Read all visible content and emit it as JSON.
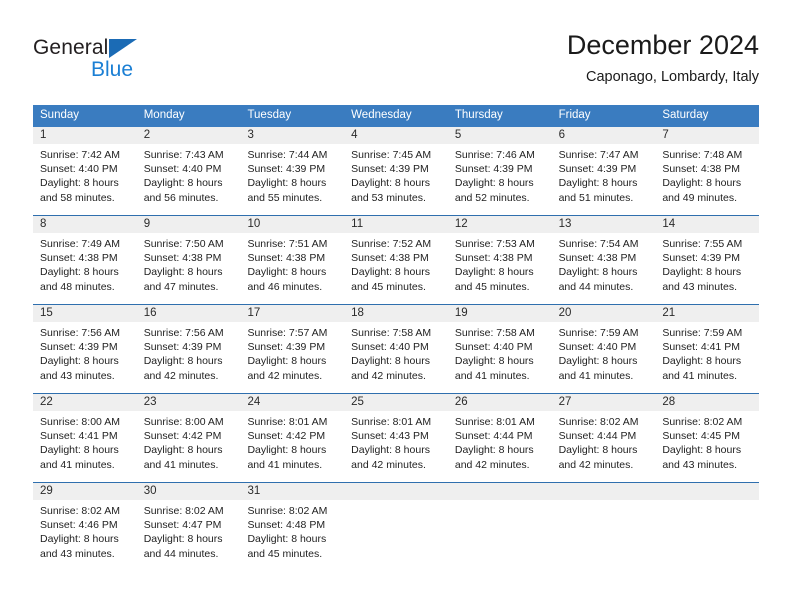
{
  "brand": {
    "name_part1": "General",
    "name_part2": "Blue",
    "triangle_icon": "triangle-icon",
    "accent_color": "#1b6bb5",
    "blue_text_color": "#1b7fd4"
  },
  "header": {
    "title": "December 2024",
    "subtitle": "Caponago, Lombardy, Italy"
  },
  "calendar": {
    "header_bg": "#3a7cc0",
    "row_separator_color": "#2f6fae",
    "day_band_bg": "#efefef",
    "weekdays": [
      "Sunday",
      "Monday",
      "Tuesday",
      "Wednesday",
      "Thursday",
      "Friday",
      "Saturday"
    ],
    "weeks": [
      [
        {
          "day": "1",
          "sunrise": "Sunrise: 7:42 AM",
          "sunset": "Sunset: 4:40 PM",
          "daylight_line1": "Daylight: 8 hours",
          "daylight_line2": "and 58 minutes."
        },
        {
          "day": "2",
          "sunrise": "Sunrise: 7:43 AM",
          "sunset": "Sunset: 4:40 PM",
          "daylight_line1": "Daylight: 8 hours",
          "daylight_line2": "and 56 minutes."
        },
        {
          "day": "3",
          "sunrise": "Sunrise: 7:44 AM",
          "sunset": "Sunset: 4:39 PM",
          "daylight_line1": "Daylight: 8 hours",
          "daylight_line2": "and 55 minutes."
        },
        {
          "day": "4",
          "sunrise": "Sunrise: 7:45 AM",
          "sunset": "Sunset: 4:39 PM",
          "daylight_line1": "Daylight: 8 hours",
          "daylight_line2": "and 53 minutes."
        },
        {
          "day": "5",
          "sunrise": "Sunrise: 7:46 AM",
          "sunset": "Sunset: 4:39 PM",
          "daylight_line1": "Daylight: 8 hours",
          "daylight_line2": "and 52 minutes."
        },
        {
          "day": "6",
          "sunrise": "Sunrise: 7:47 AM",
          "sunset": "Sunset: 4:39 PM",
          "daylight_line1": "Daylight: 8 hours",
          "daylight_line2": "and 51 minutes."
        },
        {
          "day": "7",
          "sunrise": "Sunrise: 7:48 AM",
          "sunset": "Sunset: 4:38 PM",
          "daylight_line1": "Daylight: 8 hours",
          "daylight_line2": "and 49 minutes."
        }
      ],
      [
        {
          "day": "8",
          "sunrise": "Sunrise: 7:49 AM",
          "sunset": "Sunset: 4:38 PM",
          "daylight_line1": "Daylight: 8 hours",
          "daylight_line2": "and 48 minutes."
        },
        {
          "day": "9",
          "sunrise": "Sunrise: 7:50 AM",
          "sunset": "Sunset: 4:38 PM",
          "daylight_line1": "Daylight: 8 hours",
          "daylight_line2": "and 47 minutes."
        },
        {
          "day": "10",
          "sunrise": "Sunrise: 7:51 AM",
          "sunset": "Sunset: 4:38 PM",
          "daylight_line1": "Daylight: 8 hours",
          "daylight_line2": "and 46 minutes."
        },
        {
          "day": "11",
          "sunrise": "Sunrise: 7:52 AM",
          "sunset": "Sunset: 4:38 PM",
          "daylight_line1": "Daylight: 8 hours",
          "daylight_line2": "and 45 minutes."
        },
        {
          "day": "12",
          "sunrise": "Sunrise: 7:53 AM",
          "sunset": "Sunset: 4:38 PM",
          "daylight_line1": "Daylight: 8 hours",
          "daylight_line2": "and 45 minutes."
        },
        {
          "day": "13",
          "sunrise": "Sunrise: 7:54 AM",
          "sunset": "Sunset: 4:38 PM",
          "daylight_line1": "Daylight: 8 hours",
          "daylight_line2": "and 44 minutes."
        },
        {
          "day": "14",
          "sunrise": "Sunrise: 7:55 AM",
          "sunset": "Sunset: 4:39 PM",
          "daylight_line1": "Daylight: 8 hours",
          "daylight_line2": "and 43 minutes."
        }
      ],
      [
        {
          "day": "15",
          "sunrise": "Sunrise: 7:56 AM",
          "sunset": "Sunset: 4:39 PM",
          "daylight_line1": "Daylight: 8 hours",
          "daylight_line2": "and 43 minutes."
        },
        {
          "day": "16",
          "sunrise": "Sunrise: 7:56 AM",
          "sunset": "Sunset: 4:39 PM",
          "daylight_line1": "Daylight: 8 hours",
          "daylight_line2": "and 42 minutes."
        },
        {
          "day": "17",
          "sunrise": "Sunrise: 7:57 AM",
          "sunset": "Sunset: 4:39 PM",
          "daylight_line1": "Daylight: 8 hours",
          "daylight_line2": "and 42 minutes."
        },
        {
          "day": "18",
          "sunrise": "Sunrise: 7:58 AM",
          "sunset": "Sunset: 4:40 PM",
          "daylight_line1": "Daylight: 8 hours",
          "daylight_line2": "and 42 minutes."
        },
        {
          "day": "19",
          "sunrise": "Sunrise: 7:58 AM",
          "sunset": "Sunset: 4:40 PM",
          "daylight_line1": "Daylight: 8 hours",
          "daylight_line2": "and 41 minutes."
        },
        {
          "day": "20",
          "sunrise": "Sunrise: 7:59 AM",
          "sunset": "Sunset: 4:40 PM",
          "daylight_line1": "Daylight: 8 hours",
          "daylight_line2": "and 41 minutes."
        },
        {
          "day": "21",
          "sunrise": "Sunrise: 7:59 AM",
          "sunset": "Sunset: 4:41 PM",
          "daylight_line1": "Daylight: 8 hours",
          "daylight_line2": "and 41 minutes."
        }
      ],
      [
        {
          "day": "22",
          "sunrise": "Sunrise: 8:00 AM",
          "sunset": "Sunset: 4:41 PM",
          "daylight_line1": "Daylight: 8 hours",
          "daylight_line2": "and 41 minutes."
        },
        {
          "day": "23",
          "sunrise": "Sunrise: 8:00 AM",
          "sunset": "Sunset: 4:42 PM",
          "daylight_line1": "Daylight: 8 hours",
          "daylight_line2": "and 41 minutes."
        },
        {
          "day": "24",
          "sunrise": "Sunrise: 8:01 AM",
          "sunset": "Sunset: 4:42 PM",
          "daylight_line1": "Daylight: 8 hours",
          "daylight_line2": "and 41 minutes."
        },
        {
          "day": "25",
          "sunrise": "Sunrise: 8:01 AM",
          "sunset": "Sunset: 4:43 PM",
          "daylight_line1": "Daylight: 8 hours",
          "daylight_line2": "and 42 minutes."
        },
        {
          "day": "26",
          "sunrise": "Sunrise: 8:01 AM",
          "sunset": "Sunset: 4:44 PM",
          "daylight_line1": "Daylight: 8 hours",
          "daylight_line2": "and 42 minutes."
        },
        {
          "day": "27",
          "sunrise": "Sunrise: 8:02 AM",
          "sunset": "Sunset: 4:44 PM",
          "daylight_line1": "Daylight: 8 hours",
          "daylight_line2": "and 42 minutes."
        },
        {
          "day": "28",
          "sunrise": "Sunrise: 8:02 AM",
          "sunset": "Sunset: 4:45 PM",
          "daylight_line1": "Daylight: 8 hours",
          "daylight_line2": "and 43 minutes."
        }
      ],
      [
        {
          "day": "29",
          "sunrise": "Sunrise: 8:02 AM",
          "sunset": "Sunset: 4:46 PM",
          "daylight_line1": "Daylight: 8 hours",
          "daylight_line2": "and 43 minutes."
        },
        {
          "day": "30",
          "sunrise": "Sunrise: 8:02 AM",
          "sunset": "Sunset: 4:47 PM",
          "daylight_line1": "Daylight: 8 hours",
          "daylight_line2": "and 44 minutes."
        },
        {
          "day": "31",
          "sunrise": "Sunrise: 8:02 AM",
          "sunset": "Sunset: 4:48 PM",
          "daylight_line1": "Daylight: 8 hours",
          "daylight_line2": "and 45 minutes."
        },
        {
          "day": "",
          "sunrise": "",
          "sunset": "",
          "daylight_line1": "",
          "daylight_line2": ""
        },
        {
          "day": "",
          "sunrise": "",
          "sunset": "",
          "daylight_line1": "",
          "daylight_line2": ""
        },
        {
          "day": "",
          "sunrise": "",
          "sunset": "",
          "daylight_line1": "",
          "daylight_line2": ""
        },
        {
          "day": "",
          "sunrise": "",
          "sunset": "",
          "daylight_line1": "",
          "daylight_line2": ""
        }
      ]
    ]
  }
}
